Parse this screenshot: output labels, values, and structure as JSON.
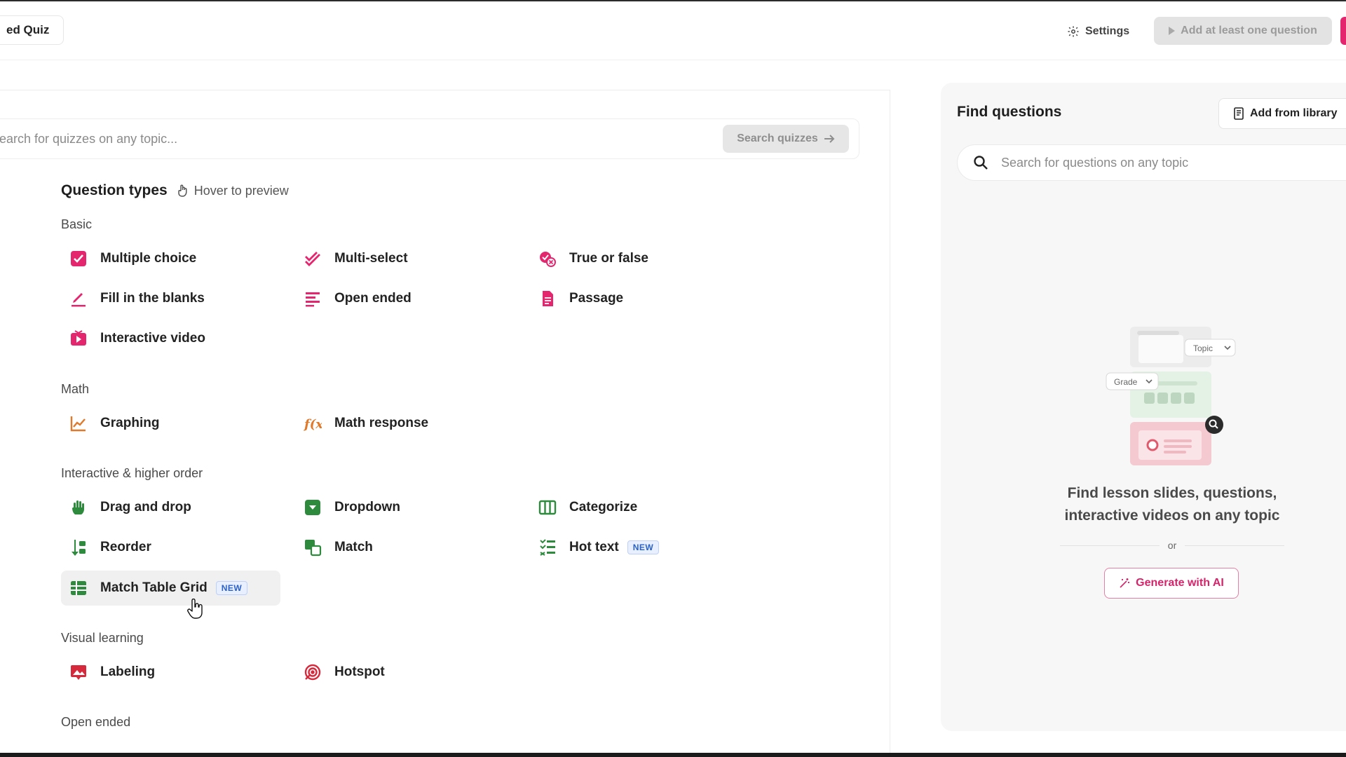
{
  "topbar": {
    "quiz_title": "ed Quiz",
    "settings_label": "Settings",
    "publish_label": "Add at least one question"
  },
  "search": {
    "placeholder": "earch for quizzes on any topic...",
    "button_label": "Search quizzes"
  },
  "question_types": {
    "title": "Question types",
    "hover_hint": "Hover to preview",
    "sections": {
      "basic": "Basic",
      "math": "Math",
      "interactive": "Interactive & higher order",
      "visual": "Visual learning",
      "open_ended": "Open ended"
    },
    "items": {
      "multiple_choice": "Multiple choice",
      "multi_select": "Multi-select",
      "true_false": "True or false",
      "fill_blanks": "Fill in the blanks",
      "open_ended": "Open ended",
      "passage": "Passage",
      "interactive_video": "Interactive video",
      "graphing": "Graphing",
      "math_response": "Math response",
      "drag_drop": "Drag and drop",
      "dropdown": "Dropdown",
      "categorize": "Categorize",
      "reorder": "Reorder",
      "match": "Match",
      "hot_text": "Hot text",
      "match_table_grid": "Match Table Grid",
      "labeling": "Labeling",
      "hotspot": "Hotspot"
    },
    "new_badge": "NEW"
  },
  "find_questions": {
    "title": "Find questions",
    "add_library_label": "Add from library",
    "search_placeholder": "Search for questions on any topic",
    "topic_chip": "Topic",
    "grade_chip": "Grade",
    "empty_line1": "Find lesson slides, questions,",
    "empty_line2": "interactive videos on any topic",
    "or_label": "or",
    "generate_label": "Generate with AI"
  },
  "colors": {
    "pink": "#e3266e",
    "orange": "#e07a2a",
    "green": "#2e8b3e",
    "red": "#d62a3c",
    "badge_blue": "#2a62c9"
  }
}
